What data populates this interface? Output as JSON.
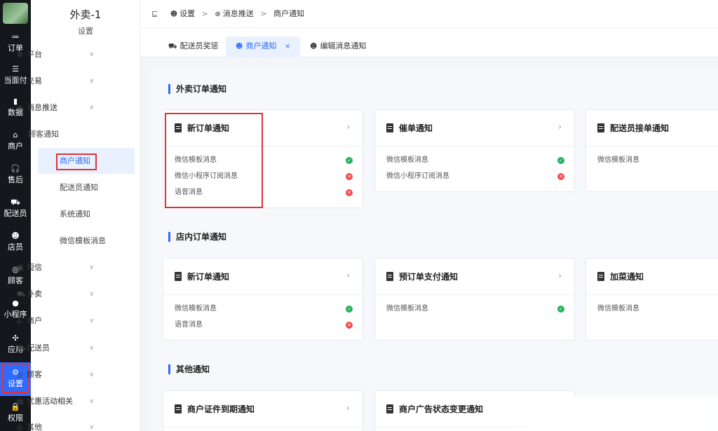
{
  "rail": {
    "items": [
      {
        "icon": "≔",
        "label": "订单"
      },
      {
        "icon": "☰",
        "label": "当面付"
      },
      {
        "icon": "▮",
        "label": "数据"
      },
      {
        "icon": "⌂",
        "label": "商户"
      },
      {
        "icon": "🎧",
        "label": "售后"
      },
      {
        "icon": "⛟",
        "label": "配送员"
      },
      {
        "icon": "☻",
        "label": "店员"
      },
      {
        "icon": "◎",
        "label": "顾客"
      },
      {
        "icon": "●",
        "label": "小程序"
      },
      {
        "icon": "✣",
        "label": "应用"
      },
      {
        "icon": "⚙",
        "label": "设置"
      },
      {
        "icon": "🔒",
        "label": "权限"
      }
    ]
  },
  "sidebar": {
    "title": "外卖-1",
    "subtitle": "设置",
    "groups": [
      {
        "icon": "⚙",
        "label": "平台"
      },
      {
        "icon": "◷",
        "label": "交易"
      },
      {
        "icon": "⊗",
        "label": "消息推送"
      },
      {
        "icon": "▣",
        "label": "短信"
      },
      {
        "icon": "⛟",
        "label": "外卖"
      },
      {
        "icon": "⌂",
        "label": "商户"
      },
      {
        "icon": "⛟",
        "label": "配送员"
      },
      {
        "icon": "◎",
        "label": "顾客"
      },
      {
        "icon": "▤",
        "label": "优惠活动相关"
      },
      {
        "icon": "◎",
        "label": "其他"
      }
    ],
    "sub_items": [
      "顾客通知",
      "商户通知",
      "配送员通知",
      "系统通知",
      "微信模板消息"
    ]
  },
  "breadcrumb": {
    "menu_icon": "⊑",
    "items": [
      "设置",
      "消息推送",
      "商户通知"
    ],
    "separator": ">"
  },
  "tabs": [
    {
      "label": "配送员奖惩"
    },
    {
      "label": "商户通知",
      "close": "×"
    },
    {
      "label": "编辑消息通知"
    }
  ],
  "sections": [
    {
      "title": "外卖订单通知"
    },
    {
      "title": "店内订单通知"
    },
    {
      "title": "其他通知"
    }
  ],
  "cards": [
    {
      "title": "新订单通知",
      "arrow": "›",
      "rows": [
        {
          "label": "微信模板消息",
          "status": "ok"
        },
        {
          "label": "微信小程序订阅消息",
          "status": "no"
        },
        {
          "label": "语音消息",
          "status": "no"
        }
      ]
    },
    {
      "title": "催单通知",
      "arrow": "›",
      "rows": [
        {
          "label": "微信模板消息",
          "status": "ok"
        },
        {
          "label": "微信小程序订阅消息",
          "status": "no"
        }
      ]
    },
    {
      "title": "配送员接单通知",
      "rows": [
        {
          "label": "微信模板消息"
        }
      ]
    },
    {
      "title": "新订单通知",
      "arrow": "›",
      "rows": [
        {
          "label": "微信模板消息",
          "status": "ok"
        },
        {
          "label": "语音消息",
          "status": "no"
        }
      ]
    },
    {
      "title": "预订单支付通知",
      "arrow": "›",
      "rows": [
        {
          "label": "微信模板消息",
          "status": "ok"
        }
      ]
    },
    {
      "title": "加菜通知",
      "rows": [
        {
          "label": "微信模板消息"
        }
      ]
    },
    {
      "title": "商户证件到期通知",
      "arrow": "›",
      "rows": []
    },
    {
      "title": "商户广告状态变更通知",
      "rows": []
    }
  ],
  "status_glyphs": {
    "ok": "✓",
    "no": "✕"
  },
  "colors": {
    "accent": "#2f6bff",
    "ok": "#22b35e",
    "error": "#f04b4b",
    "highlight": "#e0313b"
  }
}
